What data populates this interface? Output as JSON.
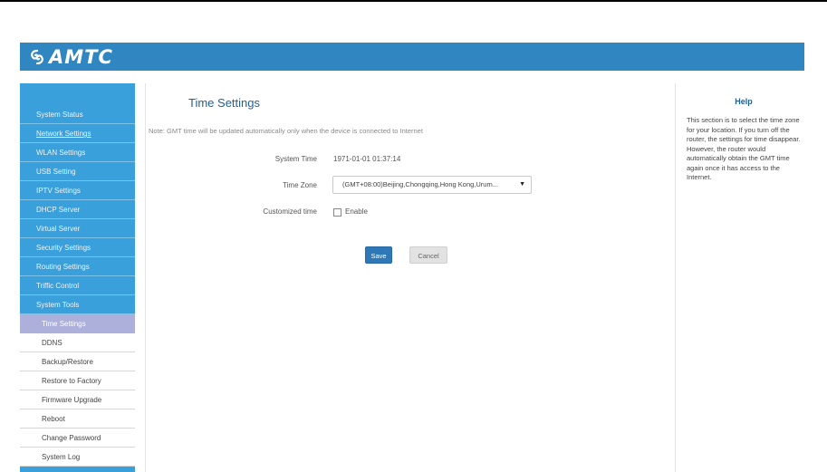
{
  "brand": {
    "name": "AMTC",
    "color": "#2f86c0"
  },
  "sidebar": {
    "items": [
      {
        "label": "System Status"
      },
      {
        "label": "Network Settings"
      },
      {
        "label": "WLAN Settings"
      },
      {
        "label": "USB Setting"
      },
      {
        "label": "IPTV Settings"
      },
      {
        "label": "DHCP Server"
      },
      {
        "label": "Virtual Server"
      },
      {
        "label": "Security Settings"
      },
      {
        "label": "Routing Settings"
      },
      {
        "label": "Triffic Control"
      },
      {
        "label": "System Tools"
      }
    ],
    "subitems": [
      {
        "label": "Time Settings"
      },
      {
        "label": "DDNS"
      },
      {
        "label": "Backup/Restore"
      },
      {
        "label": "Restore to Factory"
      },
      {
        "label": "Firmware Upgrade"
      },
      {
        "label": "Reboot"
      },
      {
        "label": "Change Password"
      },
      {
        "label": "System Log"
      }
    ]
  },
  "main": {
    "title": "Time Settings",
    "note": "Note: GMT time will be updated automatically only when the device is connected to Internet",
    "system_time_label": "System Time",
    "system_time_value": "1971-01-01 01:37:14",
    "time_zone_label": "Time Zone",
    "time_zone_value": "(GMT+08:00)Beijing,Chongqing,Hong Kong,Urum...",
    "customized_time_label": "Customized time",
    "enable_label": "Enable",
    "save_label": "Save",
    "cancel_label": "Cancel"
  },
  "help": {
    "title": "Help",
    "text": "This section is to select the time zone for your location. If you turn off the router, the settings for time disappear. However, the router would automatically obtain the GMT time again once it has access to the Internet."
  }
}
